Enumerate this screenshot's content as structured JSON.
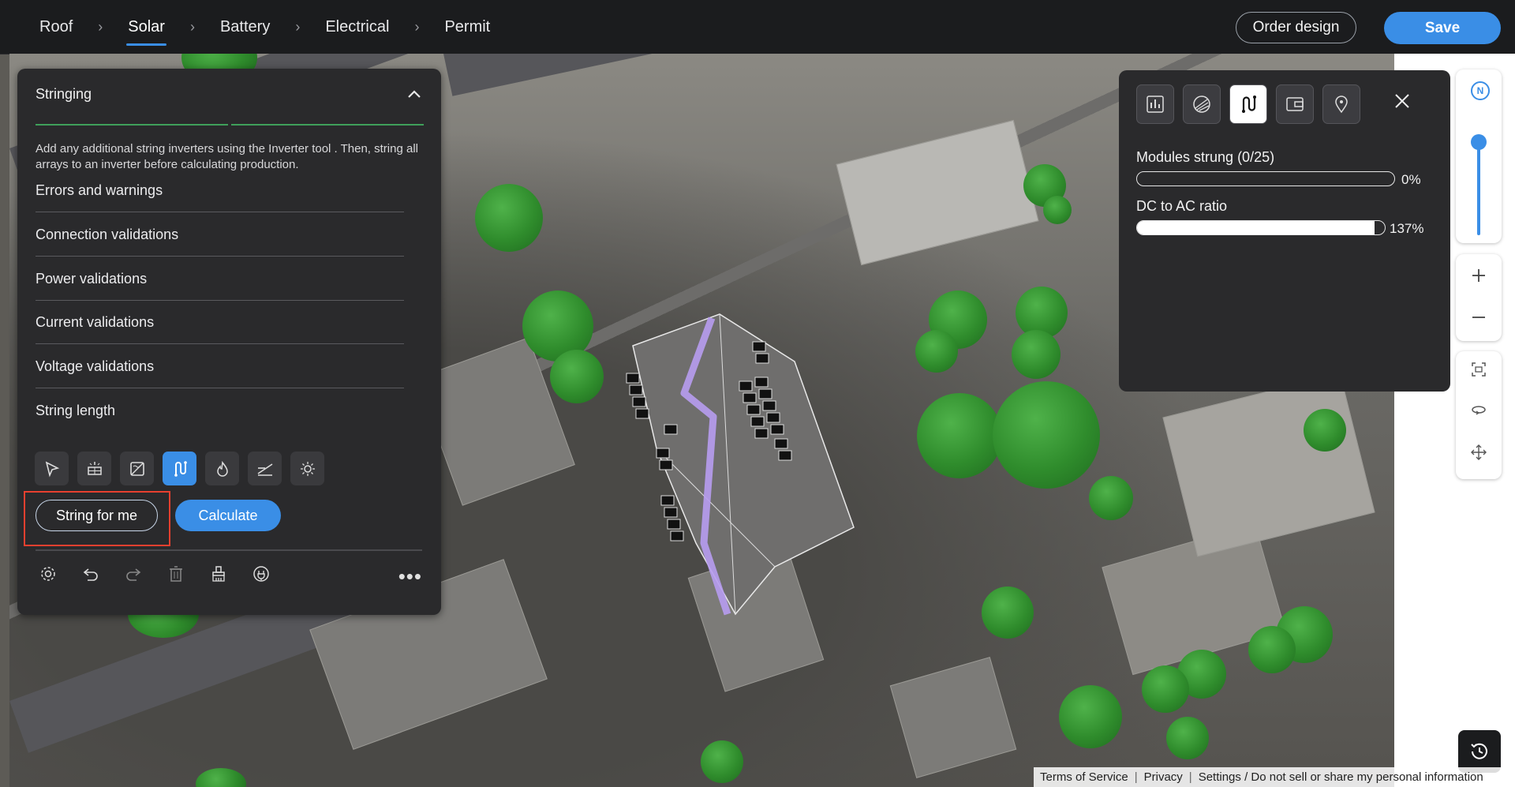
{
  "nav": {
    "crumbs": [
      "Roof",
      "Solar",
      "Battery",
      "Electrical",
      "Permit"
    ],
    "active_index": 1,
    "order_design_label": "Order design",
    "save_label": "Save"
  },
  "stringing_panel": {
    "title": "Stringing",
    "description": "Add any additional string inverters using the Inverter tool . Then, string all arrays to an inverter before calculating production.",
    "sections": [
      "Errors and warnings",
      "Connection validations",
      "Power validations",
      "Current validations",
      "Voltage validations",
      "String length"
    ],
    "tools": [
      "select-icon",
      "array-icon",
      "inverter-icon",
      "stringing-icon",
      "fire-setback-icon",
      "wire-icon",
      "irradiance-icon"
    ],
    "active_tool": "stringing-icon",
    "string_for_me_label": "String for me",
    "calculate_label": "Calculate",
    "bottom_tools": [
      "settings-icon",
      "undo-icon",
      "redo-icon",
      "trash-icon",
      "clear-icon",
      "power-icon"
    ],
    "more_label": "•••"
  },
  "metrics_panel": {
    "tabs": [
      "chart-icon",
      "shade-icon",
      "stringing-icon",
      "wallet-icon",
      "location-icon"
    ],
    "active_tab": "stringing-icon",
    "modules_strung_label": "Modules strung (0/25)",
    "modules_strung_value": "0%",
    "modules_strung_fraction": 0.0,
    "dc_ac_label": "DC to AC ratio",
    "dc_ac_value": "137%",
    "dc_ac_fraction": 0.96
  },
  "map_controls": {
    "compass_label": "N"
  },
  "footer": {
    "terms": "Terms of Service",
    "privacy": "Privacy",
    "settings": "Settings / Do not sell or share my personal information"
  },
  "colors": {
    "accent": "#3a8ee6",
    "panel_bg": "#2a2a2c",
    "highlight": "#e8402f",
    "string_path": "#b79cf0"
  }
}
